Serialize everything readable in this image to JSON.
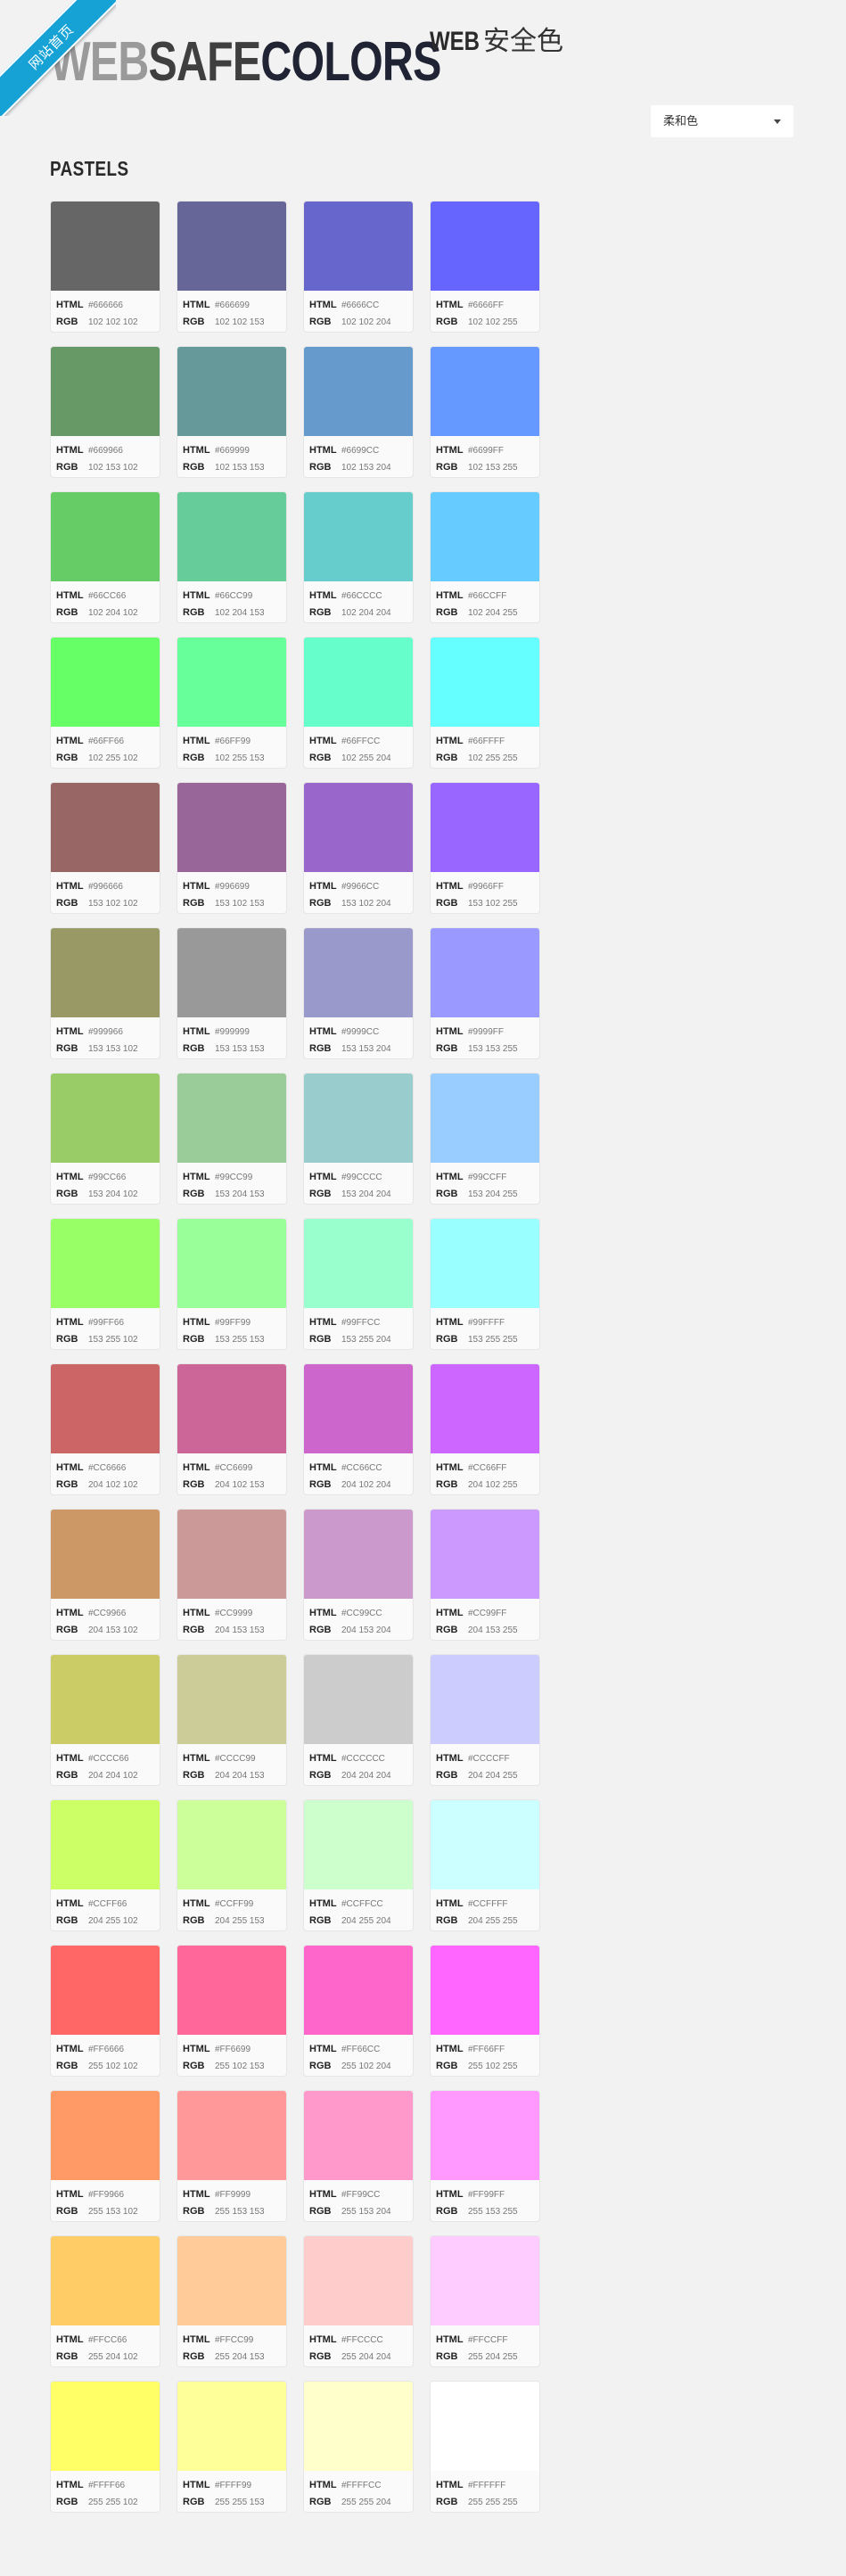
{
  "ribbon": {
    "label": "网站首页"
  },
  "logo": {
    "part1": "WEB",
    "part2": "SAFE",
    "part3": "COLORS"
  },
  "subtitle": {
    "web": "WEB",
    "text": "安全色"
  },
  "filter": {
    "selected": "柔和色"
  },
  "section": {
    "title": "PASTELS"
  },
  "labels": {
    "html": "HTML",
    "rgb": "RGB"
  },
  "colors": [
    {
      "hex": "#666666",
      "rgb": "102 102 102"
    },
    {
      "hex": "#666699",
      "rgb": "102 102 153"
    },
    {
      "hex": "#6666CC",
      "rgb": "102 102 204"
    },
    {
      "hex": "#6666FF",
      "rgb": "102 102 255"
    },
    {
      "hex": "#669966",
      "rgb": "102 153 102"
    },
    {
      "hex": "#669999",
      "rgb": "102 153 153"
    },
    {
      "hex": "#6699CC",
      "rgb": "102 153 204"
    },
    {
      "hex": "#6699FF",
      "rgb": "102 153 255"
    },
    {
      "hex": "#66CC66",
      "rgb": "102 204 102"
    },
    {
      "hex": "#66CC99",
      "rgb": "102 204 153"
    },
    {
      "hex": "#66CCCC",
      "rgb": "102 204 204"
    },
    {
      "hex": "#66CCFF",
      "rgb": "102 204 255"
    },
    {
      "hex": "#66FF66",
      "rgb": "102 255 102"
    },
    {
      "hex": "#66FF99",
      "rgb": "102 255 153"
    },
    {
      "hex": "#66FFCC",
      "rgb": "102 255 204"
    },
    {
      "hex": "#66FFFF",
      "rgb": "102 255 255"
    },
    {
      "hex": "#996666",
      "rgb": "153 102 102"
    },
    {
      "hex": "#996699",
      "rgb": "153 102 153"
    },
    {
      "hex": "#9966CC",
      "rgb": "153 102 204"
    },
    {
      "hex": "#9966FF",
      "rgb": "153 102 255"
    },
    {
      "hex": "#999966",
      "rgb": "153 153 102"
    },
    {
      "hex": "#999999",
      "rgb": "153 153 153"
    },
    {
      "hex": "#9999CC",
      "rgb": "153 153 204"
    },
    {
      "hex": "#9999FF",
      "rgb": "153 153 255"
    },
    {
      "hex": "#99CC66",
      "rgb": "153 204 102"
    },
    {
      "hex": "#99CC99",
      "rgb": "153 204 153"
    },
    {
      "hex": "#99CCCC",
      "rgb": "153 204 204"
    },
    {
      "hex": "#99CCFF",
      "rgb": "153 204 255"
    },
    {
      "hex": "#99FF66",
      "rgb": "153 255 102"
    },
    {
      "hex": "#99FF99",
      "rgb": "153 255 153"
    },
    {
      "hex": "#99FFCC",
      "rgb": "153 255 204"
    },
    {
      "hex": "#99FFFF",
      "rgb": "153 255 255"
    },
    {
      "hex": "#CC6666",
      "rgb": "204 102 102"
    },
    {
      "hex": "#CC6699",
      "rgb": "204 102 153"
    },
    {
      "hex": "#CC66CC",
      "rgb": "204 102 204"
    },
    {
      "hex": "#CC66FF",
      "rgb": "204 102 255"
    },
    {
      "hex": "#CC9966",
      "rgb": "204 153 102"
    },
    {
      "hex": "#CC9999",
      "rgb": "204 153 153"
    },
    {
      "hex": "#CC99CC",
      "rgb": "204 153 204"
    },
    {
      "hex": "#CC99FF",
      "rgb": "204 153 255"
    },
    {
      "hex": "#CCCC66",
      "rgb": "204 204 102"
    },
    {
      "hex": "#CCCC99",
      "rgb": "204 204 153"
    },
    {
      "hex": "#CCCCCC",
      "rgb": "204 204 204"
    },
    {
      "hex": "#CCCCFF",
      "rgb": "204 204 255"
    },
    {
      "hex": "#CCFF66",
      "rgb": "204 255 102"
    },
    {
      "hex": "#CCFF99",
      "rgb": "204 255 153"
    },
    {
      "hex": "#CCFFCC",
      "rgb": "204 255 204"
    },
    {
      "hex": "#CCFFFF",
      "rgb": "204 255 255"
    },
    {
      "hex": "#FF6666",
      "rgb": "255 102 102"
    },
    {
      "hex": "#FF6699",
      "rgb": "255 102 153"
    },
    {
      "hex": "#FF66CC",
      "rgb": "255 102 204"
    },
    {
      "hex": "#FF66FF",
      "rgb": "255 102 255"
    },
    {
      "hex": "#FF9966",
      "rgb": "255 153 102"
    },
    {
      "hex": "#FF9999",
      "rgb": "255 153 153"
    },
    {
      "hex": "#FF99CC",
      "rgb": "255 153 204"
    },
    {
      "hex": "#FF99FF",
      "rgb": "255 153 255"
    },
    {
      "hex": "#FFCC66",
      "rgb": "255 204 102"
    },
    {
      "hex": "#FFCC99",
      "rgb": "255 204 153"
    },
    {
      "hex": "#FFCCCC",
      "rgb": "255 204 204"
    },
    {
      "hex": "#FFCCFF",
      "rgb": "255 204 255"
    },
    {
      "hex": "#FFFF66",
      "rgb": "255 255 102"
    },
    {
      "hex": "#FFFF99",
      "rgb": "255 255 153"
    },
    {
      "hex": "#FFFFCC",
      "rgb": "255 255 204"
    },
    {
      "hex": "#FFFFFF",
      "rgb": "255 255 255"
    }
  ]
}
